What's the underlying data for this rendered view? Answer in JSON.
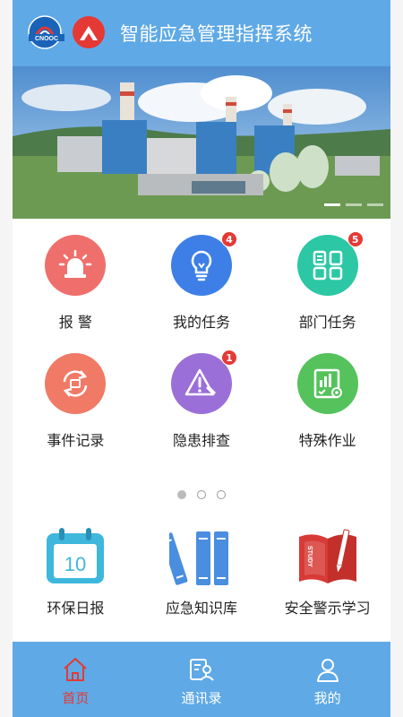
{
  "header": {
    "title": "智能应急管理指挥系统",
    "logo_text": "CNOOC",
    "logo_icon": "cnooc-logo",
    "logo2_icon": "company-logo"
  },
  "banner": {
    "image": "power-plant-photo",
    "slides": 3,
    "active_slide": 0
  },
  "grid": [
    {
      "label": "报 警",
      "icon": "alarm-icon",
      "color": "#ef6f6c",
      "badge": null
    },
    {
      "label": "我的任务",
      "icon": "lightbulb-icon",
      "color": "#3d7fe6",
      "badge": "4"
    },
    {
      "label": "部门任务",
      "icon": "department-tasks-icon",
      "color": "#2cc7a4",
      "badge": "5"
    },
    {
      "label": "事件记录",
      "icon": "event-record-icon",
      "color": "#f07a66",
      "badge": null
    },
    {
      "label": "隐患排查",
      "icon": "hazard-check-icon",
      "color": "#9b6fd8",
      "badge": "1"
    },
    {
      "label": "特殊作业",
      "icon": "special-work-icon",
      "color": "#55c25c",
      "badge": null
    }
  ],
  "pager": {
    "count": 3,
    "active": 0
  },
  "grid2": [
    {
      "label": "环保日报",
      "icon": "calendar-icon",
      "color": "#3fb7dd",
      "day": "10"
    },
    {
      "label": "应急知识库",
      "icon": "books-icon",
      "color": "#4a8ee0"
    },
    {
      "label": "安全警示学习",
      "icon": "study-book-icon",
      "color": "#d83a35",
      "book_text": "STUDY"
    }
  ],
  "nav": [
    {
      "label": "首页",
      "icon": "home-icon",
      "active": true
    },
    {
      "label": "通讯录",
      "icon": "contacts-icon",
      "active": false
    },
    {
      "label": "我的",
      "icon": "profile-icon",
      "active": false
    }
  ],
  "colors": {
    "header_bg": "#5fa9e6",
    "nav_bg": "#5fa9e6",
    "nav_active": "#e53935",
    "badge": "#e53935"
  }
}
